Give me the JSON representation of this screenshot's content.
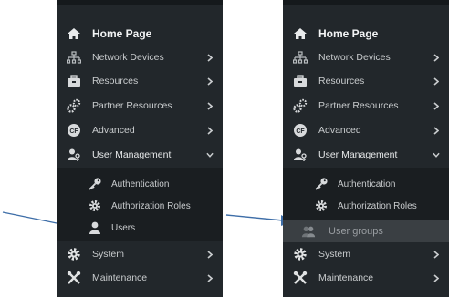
{
  "colors": {
    "sidebar_bg": "#22272b",
    "submenu_bg": "#1a1e21",
    "highlight_bg": "#3a3f43",
    "text": "#c9ccce",
    "arrow": "#3e6ea8"
  },
  "left_menu": {
    "items": [
      {
        "label": "Home Page",
        "icon": "home-icon"
      },
      {
        "label": "Network Devices",
        "icon": "network-icon",
        "chevron": "right"
      },
      {
        "label": "Resources",
        "icon": "toolbox-icon",
        "chevron": "right"
      },
      {
        "label": "Partner Resources",
        "icon": "gears-icon",
        "chevron": "right"
      },
      {
        "label": "Advanced",
        "icon": "advanced-icon",
        "chevron": "right"
      },
      {
        "label": "User Management",
        "icon": "user-key-icon",
        "chevron": "down"
      }
    ],
    "submenu": [
      {
        "label": "Authentication",
        "icon": "key-icon"
      },
      {
        "label": "Authorization Roles",
        "icon": "gear-icon"
      },
      {
        "label": "Users",
        "icon": "user-icon"
      }
    ],
    "bottom": [
      {
        "label": "System",
        "icon": "cog-icon",
        "chevron": "right"
      },
      {
        "label": "Maintenance",
        "icon": "tools-icon",
        "chevron": "right"
      }
    ]
  },
  "right_menu": {
    "items": [
      {
        "label": "Home Page",
        "icon": "home-icon"
      },
      {
        "label": "Network Devices",
        "icon": "network-icon",
        "chevron": "right"
      },
      {
        "label": "Resources",
        "icon": "toolbox-icon",
        "chevron": "right"
      },
      {
        "label": "Partner Resources",
        "icon": "gears-icon",
        "chevron": "right"
      },
      {
        "label": "Advanced",
        "icon": "advanced-icon",
        "chevron": "right"
      },
      {
        "label": "User Management",
        "icon": "user-key-icon",
        "chevron": "down"
      }
    ],
    "submenu": [
      {
        "label": "Authentication",
        "icon": "key-icon"
      },
      {
        "label": "Authorization Roles",
        "icon": "gear-icon"
      },
      {
        "label": "User groups",
        "icon": "user-group-icon"
      }
    ],
    "bottom": [
      {
        "label": "System",
        "icon": "cog-icon",
        "chevron": "right"
      },
      {
        "label": "Maintenance",
        "icon": "tools-icon",
        "chevron": "right"
      }
    ]
  }
}
